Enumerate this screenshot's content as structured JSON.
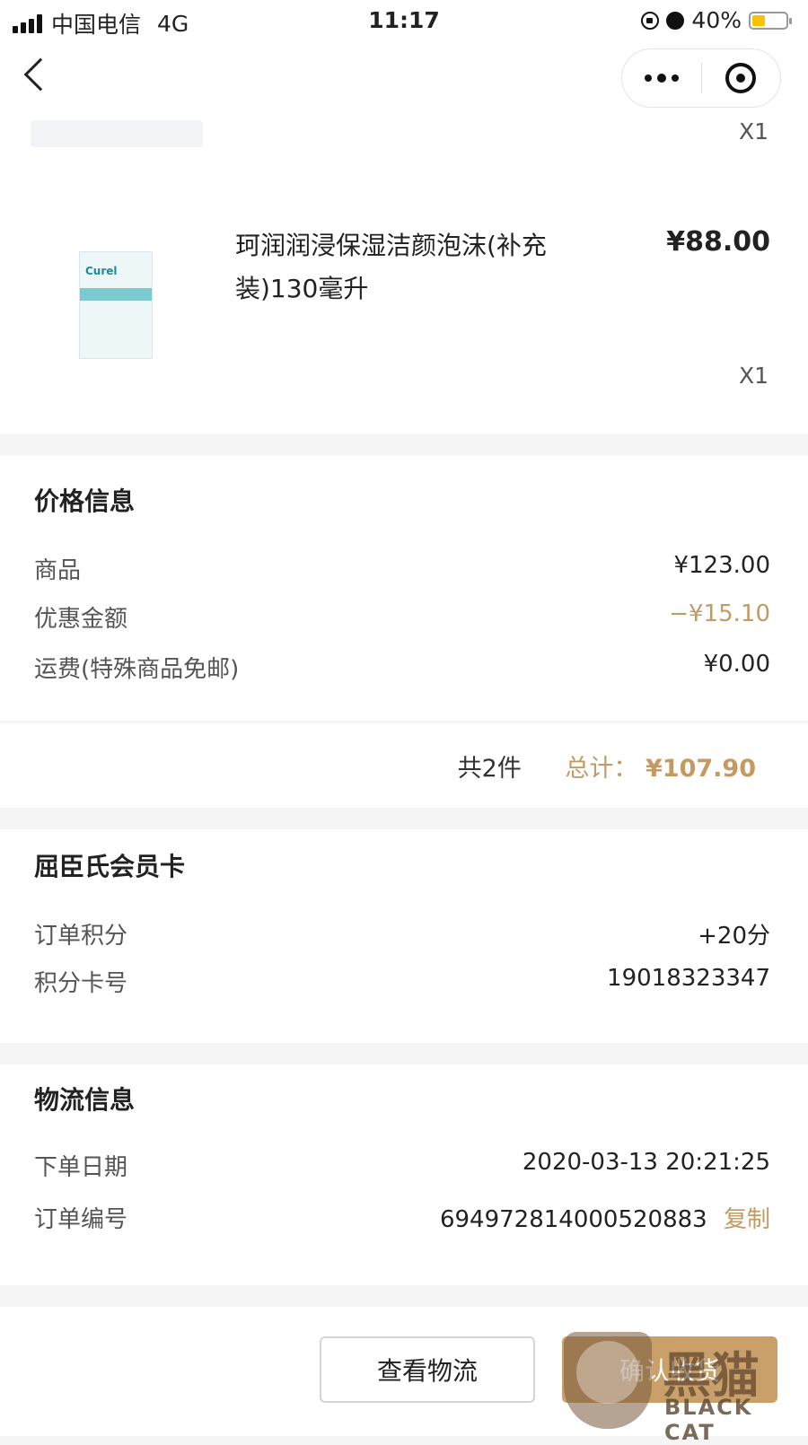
{
  "status_bar": {
    "carrier": "中国电信",
    "network": "4G",
    "time": "11:17",
    "battery_percent": "40%",
    "battery_level": 0.4,
    "battery_color": "#f6c300"
  },
  "nav": {
    "back_icon": "chevron-left-icon",
    "more_icon": "more-dots-icon",
    "close_icon": "target-circle-icon"
  },
  "items": {
    "qty_top": "X1",
    "product_name": "珂润润浸保湿洁颜泡沫(补充装)130毫升",
    "product_price": "¥88.00",
    "product_qty": "X1",
    "thumb_logo": "Curel"
  },
  "price_info": {
    "title": "价格信息",
    "goods_label": "商品",
    "goods_value": "¥123.00",
    "discount_label": "优惠金额",
    "discount_value": "−¥15.10",
    "shipping_label": "运费(特殊商品免邮)",
    "shipping_value": "¥0.00",
    "count_text": "共2件",
    "total_label": "总计：",
    "total_value": "¥107.90"
  },
  "member": {
    "title": "屈臣氏会员卡",
    "points_label": "订单积分",
    "points_value": "+20分",
    "card_label": "积分卡号",
    "card_value": "19018323347"
  },
  "logistics": {
    "title": "物流信息",
    "date_label": "下单日期",
    "date_value": "2020-03-13 20:21:25",
    "order_label": "订单编号",
    "order_value": "694972814000520883",
    "copy_label": "复制"
  },
  "actions": {
    "view_logistics": "查看物流",
    "confirm_receipt": "确认收货"
  },
  "watermark": {
    "brand_cn": "黑猫",
    "brand_en": "BLACK CAT"
  },
  "colors": {
    "accent_gold": "#c49a62",
    "button_gold": "#c9a06a"
  }
}
